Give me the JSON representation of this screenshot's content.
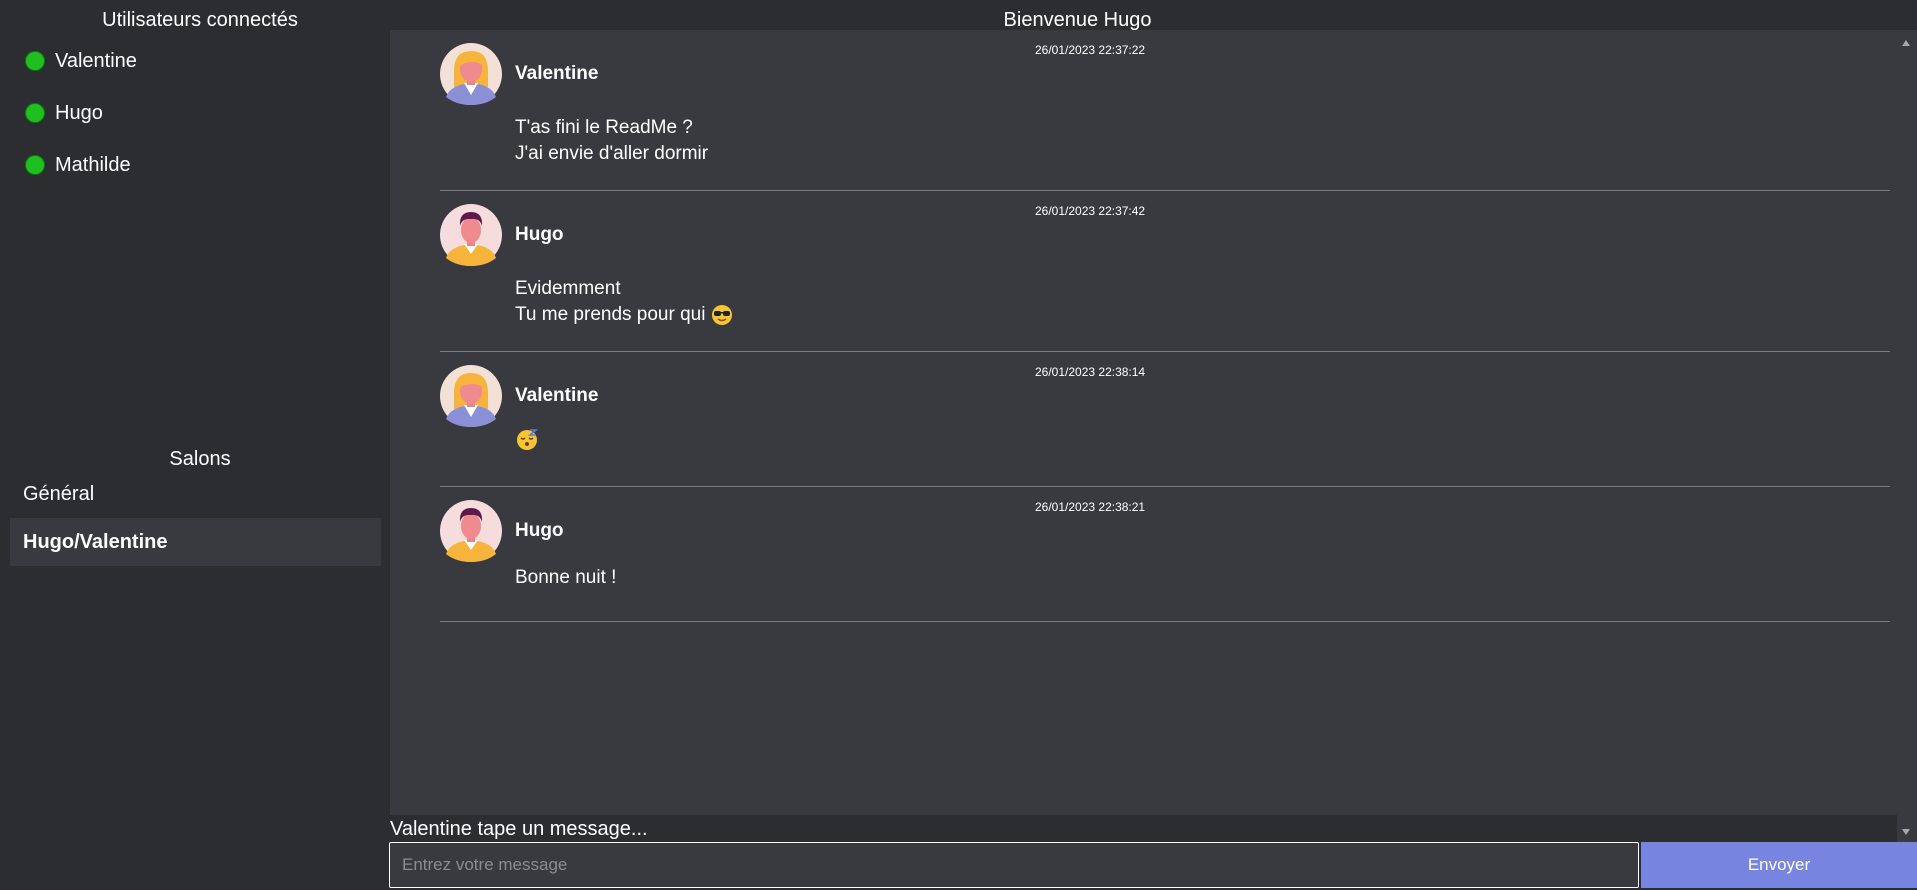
{
  "sidebar": {
    "users_title": "Utilisateurs connectés",
    "users": [
      {
        "name": "Valentine",
        "status_color": "#1fbf1f"
      },
      {
        "name": "Hugo",
        "status_color": "#1fbf1f"
      },
      {
        "name": "Mathilde",
        "status_color": "#1fbf1f"
      }
    ],
    "rooms_title": "Salons",
    "rooms": [
      {
        "name": "Général",
        "active": false
      },
      {
        "name": "Hugo/Valentine",
        "active": true
      }
    ]
  },
  "header": {
    "welcome": "Bienvenue Hugo"
  },
  "messages": [
    {
      "author": "Valentine",
      "avatar": "female-avatar-icon",
      "timestamp": "26/01/2023 22:37:22",
      "lines": [
        "T'as fini le ReadMe ?",
        "J'ai envie d'aller dormir"
      ]
    },
    {
      "author": "Hugo",
      "avatar": "male-avatar-icon",
      "timestamp": "26/01/2023 22:37:42",
      "lines": [
        "Evidemment",
        "Tu me prends pour qui"
      ],
      "emoji": "sunglasses-emoji-icon"
    },
    {
      "author": "Valentine",
      "avatar": "female-avatar-icon",
      "timestamp": "26/01/2023 22:38:14",
      "lines": [],
      "emoji": "sleeping-emoji-icon"
    },
    {
      "author": "Hugo",
      "avatar": "male-avatar-icon",
      "timestamp": "26/01/2023 22:38:21",
      "lines": [
        "Bonne nuit !"
      ]
    }
  ],
  "typing_indicator": "Valentine tape un message...",
  "composer": {
    "placeholder": "Entrez votre message",
    "value": "",
    "send_label": "Envoyer",
    "send_color": "#7885e0"
  },
  "colors": {
    "sidebar_bg": "#2b2d31",
    "chat_bg": "#383a40",
    "online": "#1fbf1f"
  }
}
